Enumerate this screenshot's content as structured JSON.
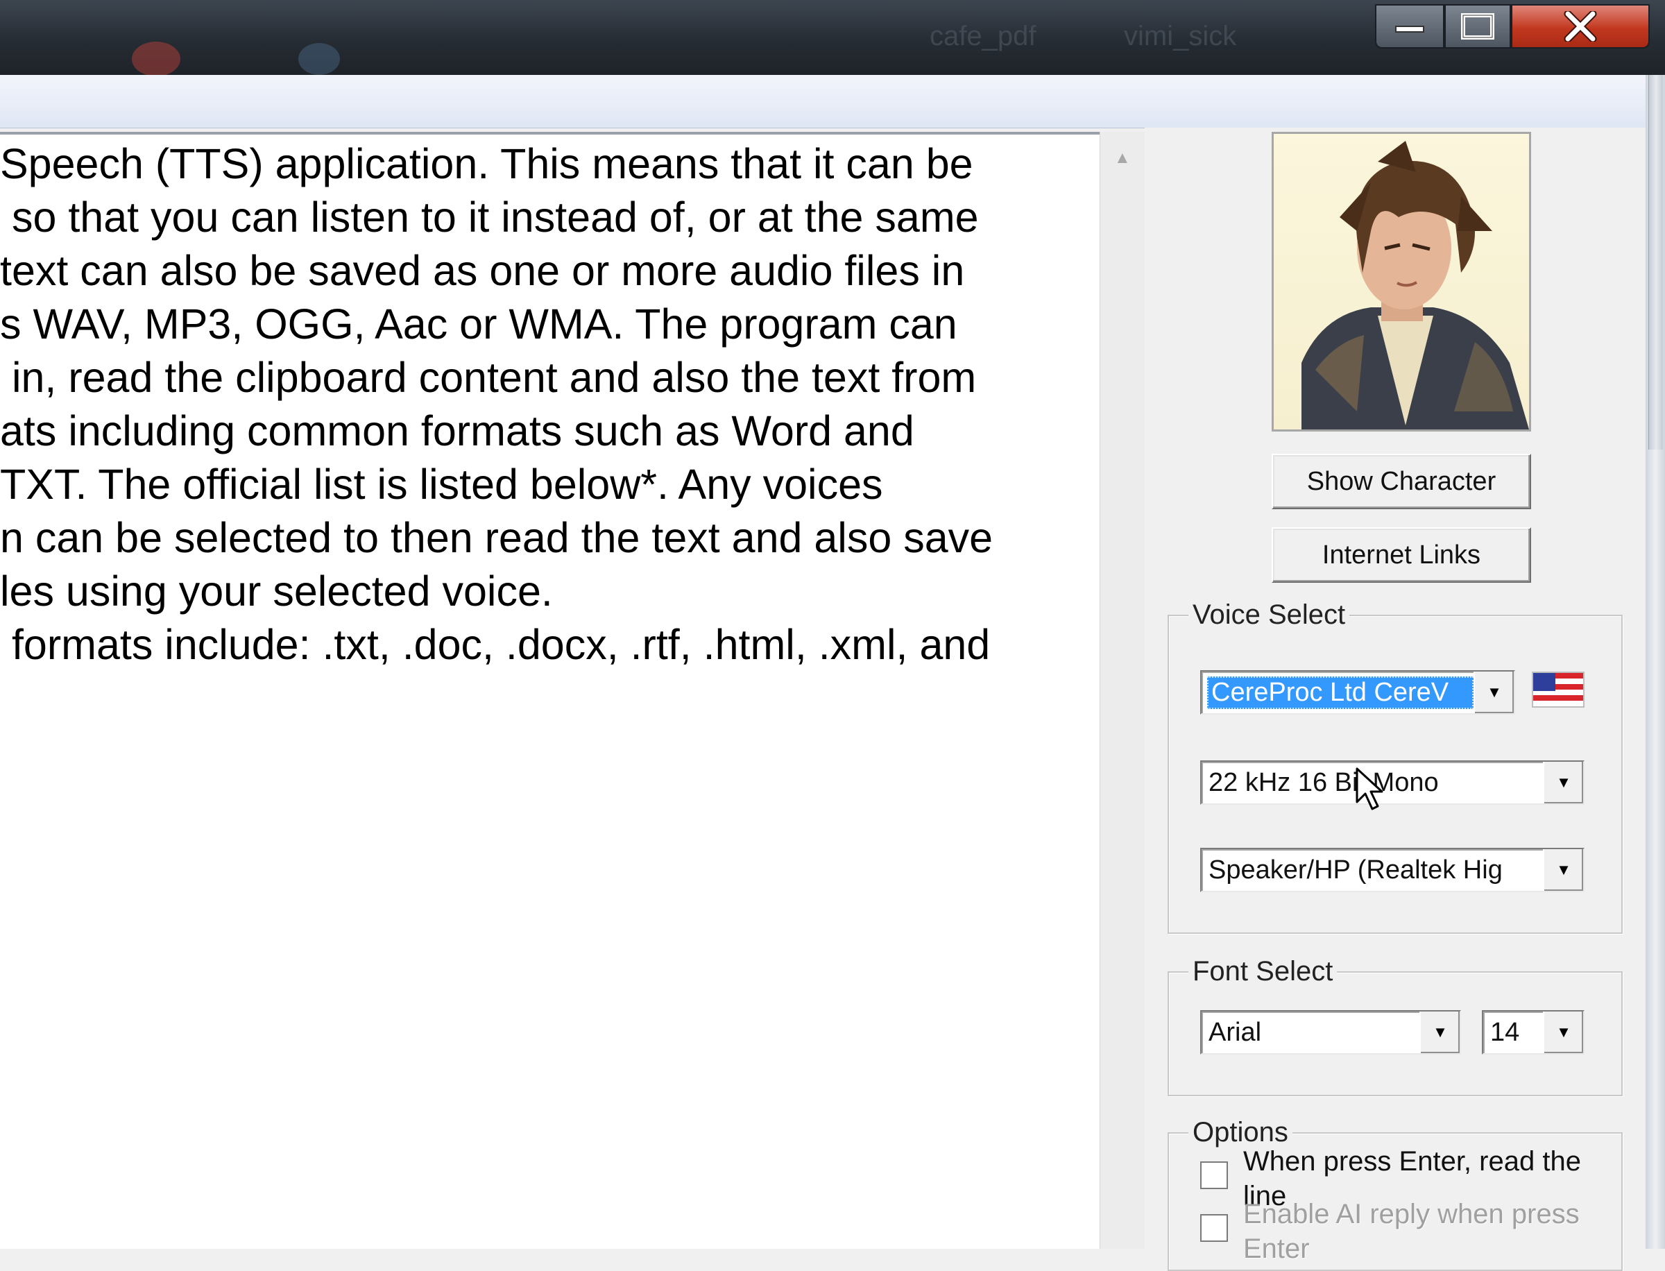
{
  "window": {
    "controls": {
      "minimize_label": "",
      "maximize_label": "",
      "close_label": "X"
    },
    "taskbar_faint": [
      "cafe_pdf",
      "vimi_sick"
    ]
  },
  "editor": {
    "lines": [
      "Speech (TTS) application. This means that it can be",
      " so that you can listen to it instead of, or at the same",
      "text can also be saved as one or more audio files in",
      "s WAV, MP3, OGG, Aac or WMA. The program can",
      " in, read the clipboard content and also the text from",
      "ats including common formats such as Word and",
      "TXT. The official list is listed below*. Any voices",
      "n can be selected to then read the text and also save",
      "les using your selected voice.",
      " formats include: .txt, .doc, .docx, .rtf, .html, .xml, and"
    ]
  },
  "panel": {
    "show_character_button": "Show Character",
    "internet_links_button": "Internet Links",
    "voice_select": {
      "legend": "Voice Select",
      "voice": "CereProc Ltd CereV",
      "format": "22 kHz 16 Bit Mono",
      "output": "Speaker/HP (Realtek Hig"
    },
    "font_select": {
      "legend": "Font Select",
      "font": "Arial",
      "size": "14"
    },
    "options": {
      "legend": "Options",
      "opt1": "When press Enter, read the",
      "opt1_cont": "line",
      "opt2": "Enable AI reply when press",
      "opt2_cont": "Enter"
    }
  },
  "colors": {
    "selection": "#3399ff",
    "close_button": "#c2381f"
  }
}
